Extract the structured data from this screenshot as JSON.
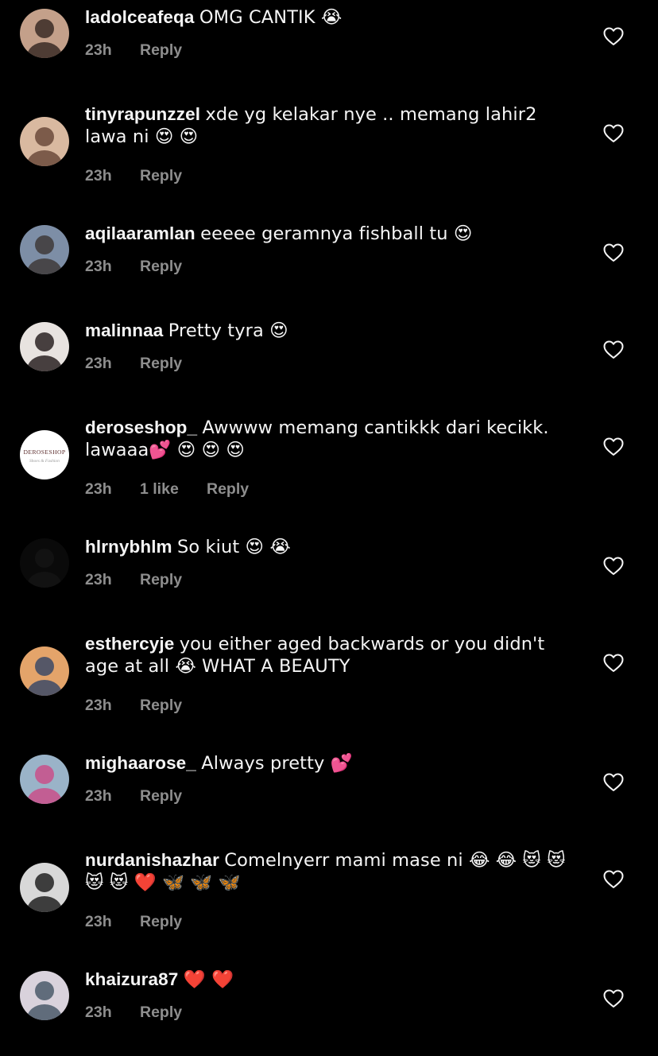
{
  "comments": [
    {
      "username": "ladolceafeqa",
      "text": "OMG CANTIK 😭",
      "time": "23h",
      "likes": "",
      "reply_label": "Reply",
      "avatar_colors": [
        "#c4a08a",
        "#3a2a24"
      ]
    },
    {
      "username": "tinyrapunzzel",
      "text": "xde yg kelakar nye .. memang lahir2 lawa ni 😍 😍",
      "time": "23h",
      "likes": "",
      "reply_label": "Reply",
      "avatar_colors": [
        "#d9b9a0",
        "#6b4a3b"
      ]
    },
    {
      "username": "aqilaaramlan",
      "text": "eeeee geramnya fishball tu 😍",
      "time": "23h",
      "likes": "",
      "reply_label": "Reply",
      "avatar_colors": [
        "#7d8ea6",
        "#3e3a38"
      ]
    },
    {
      "username": "malinnaa",
      "text": "Pretty tyra 😍",
      "time": "23h",
      "likes": "",
      "reply_label": "Reply",
      "avatar_colors": [
        "#e8e3e0",
        "#2a2222"
      ]
    },
    {
      "username": "deroseshop_",
      "text": "Awwww memang cantikkk dari kecikk. lawaaa💕 😍 😍 😍",
      "time": "23h",
      "likes": "1 like",
      "reply_label": "Reply",
      "avatar_colors": [
        "#ffffff",
        "#5a2a2a"
      ],
      "avatar_text": "DEROSESHOP"
    },
    {
      "username": "hlrnybhlm",
      "text": "So kiut 😍 😭",
      "time": "23h",
      "likes": "",
      "reply_label": "Reply",
      "avatar_colors": [
        "#0a0a0a",
        "#141414"
      ]
    },
    {
      "username": "esthercyje",
      "text": "you either aged backwards or you didn't age at all 😭 WHAT A BEAUTY",
      "time": "23h",
      "likes": "",
      "reply_label": "Reply",
      "avatar_colors": [
        "#e4a46a",
        "#3c4a66"
      ]
    },
    {
      "username": "mighaarose_",
      "text": "Always pretty 💕",
      "time": "23h",
      "likes": "",
      "reply_label": "Reply",
      "avatar_colors": [
        "#9ab3c8",
        "#c94f8a"
      ]
    },
    {
      "username": "nurdanishazhar",
      "text": "Comelnyerr mami mase ni 😂 😂 😻 😻 😻 😻 ❤️ 🦋 🦋 🦋",
      "time": "23h",
      "likes": "",
      "reply_label": "Reply",
      "avatar_colors": [
        "#d8d8d8",
        "#222222"
      ]
    },
    {
      "username": "khaizura87",
      "text": "❤️ ❤️",
      "time": "23h",
      "likes": "",
      "reply_label": "Reply",
      "avatar_colors": [
        "#d9d2dc",
        "#4a5a6a"
      ]
    }
  ]
}
